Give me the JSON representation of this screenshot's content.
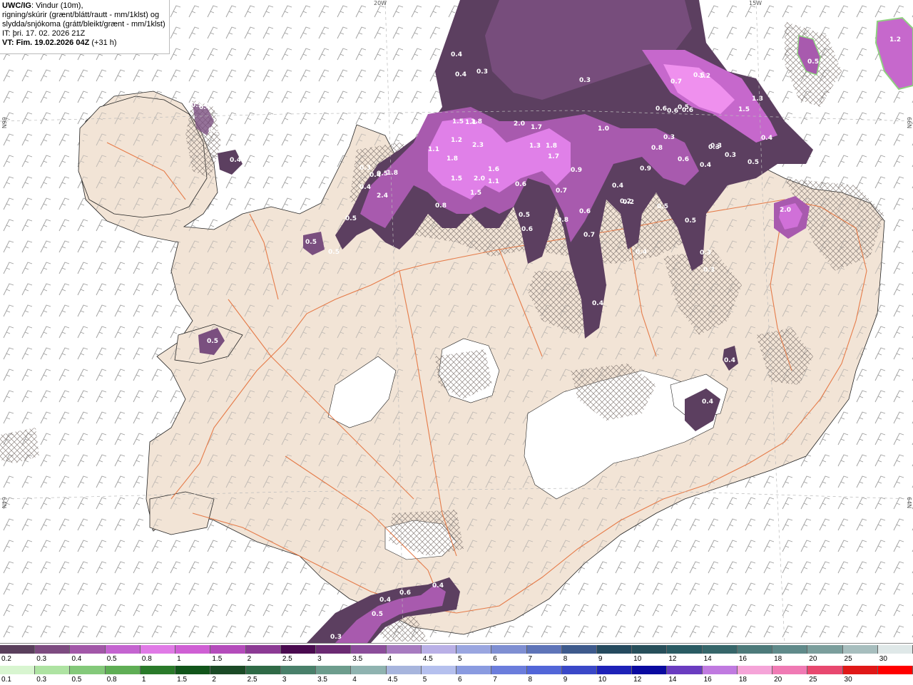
{
  "header": {
    "product": "UWC/IG",
    "line1_rest": ": Vindur (10m),",
    "line2": "rigning/skúrir (grænt/blátt/rautt - mm/1klst) og",
    "line3": "slydda/snjókoma (grátt/bleikt/grænt - mm/1klst)",
    "it_label": "IT:",
    "it_value": "þri. 17. 02. 2026 21Z",
    "vt_label": "VT:",
    "vt_value": "Fim. 19.02.2026 04Z",
    "vt_offset": "(+31 h)"
  },
  "edge_labels": {
    "top_20w": "20W",
    "top_15w": "15W",
    "left_66n": "66N",
    "left_64n": "64N",
    "right_66n": "66N",
    "right_64n": "64N"
  },
  "precip_values": [
    "0.5",
    "0.4",
    "0.3",
    "0.4",
    "0.3",
    "0.4",
    "0.3",
    "0.3",
    "0.4",
    "0.4",
    "0.5",
    "0.5",
    "0.3",
    "0.4",
    "0.5",
    "1.8",
    "2.4",
    "1.5",
    "1.1",
    "1.8",
    "1.2",
    "1.1",
    "1.5",
    "1.8",
    "2.3",
    "1.6",
    "2.0",
    "1.5",
    "1.1",
    "2.0",
    "1.7",
    "1.3",
    "1.8",
    "1.7",
    "1.0",
    "0.9",
    "0.8",
    "0.6",
    "0.7",
    "0.8",
    "0.5",
    "0.6",
    "0.7",
    "0.6",
    "0.4",
    "0.8",
    "0.9",
    "0.6",
    "0.4",
    "0.5",
    "0.3",
    "0.3",
    "0.3",
    "0.5",
    "0.4",
    "0.6",
    "0.6",
    "0.6",
    "1.5",
    "1.3",
    "0.7",
    "0.6",
    "1.2",
    "0.3",
    "0.5",
    "0.2",
    "0.3",
    "0.3",
    "0.5",
    "2.0",
    "0.4",
    "0.4",
    "0.5",
    "0.4",
    "0.6",
    "0.4",
    "0.3",
    "0.5",
    "1.2",
    "0.5",
    "0.4",
    "0.2",
    "0.4"
  ],
  "legend": {
    "snow_labels": [
      "0.2",
      "0.3",
      "0.4",
      "0.5",
      "0.8",
      "1",
      "1.5",
      "2",
      "2.5",
      "3",
      "3.5",
      "4",
      "4.5",
      "5",
      "6",
      "7",
      "8",
      "9",
      "10",
      "12",
      "14",
      "16",
      "18",
      "20",
      "25",
      "30"
    ],
    "snow_colors": [
      "#5a3f5c",
      "#7d4b80",
      "#a257a8",
      "#c464d0",
      "#e07ae6",
      "#cf5fd4",
      "#b44cbb",
      "#8c3a94",
      "#4a0a4f",
      "#6b2a72",
      "#8b4d9a",
      "#a77bc0",
      "#b9b0e6",
      "#9aa6e0",
      "#7f8fd2",
      "#5e74b8",
      "#3e5a8c",
      "#254a5e",
      "#274f5a",
      "#2a5b63",
      "#36666a",
      "#4d7a7a",
      "#608a8a",
      "#7b9e9c",
      "#a7bebe",
      "#dfe8e8"
    ],
    "rain_labels": [
      "0.1",
      "0.3",
      "0.5",
      "0.8",
      "1",
      "1.5",
      "2",
      "2.5",
      "3",
      "3.5",
      "4",
      "4.5",
      "5",
      "6",
      "7",
      "8",
      "9",
      "10",
      "12",
      "14",
      "16",
      "18",
      "20",
      "25",
      "30"
    ],
    "rain_colors": [
      "#d8f5d0",
      "#aee3a2",
      "#84c97a",
      "#5fae55",
      "#2a7a2a",
      "#11551a",
      "#1b4a26",
      "#2f6a46",
      "#49806a",
      "#6d9d8d",
      "#8fb3b0",
      "#a7b5dd",
      "#b5c0ee",
      "#8a9be0",
      "#6b7ddc",
      "#5266d8",
      "#3a48c8",
      "#1e22b8",
      "#0a0aa0",
      "#6a3cc0",
      "#c07ae0",
      "#f5a4d8",
      "#f07ab4",
      "#e8486f",
      "#e01818",
      "#ff0000"
    ]
  }
}
